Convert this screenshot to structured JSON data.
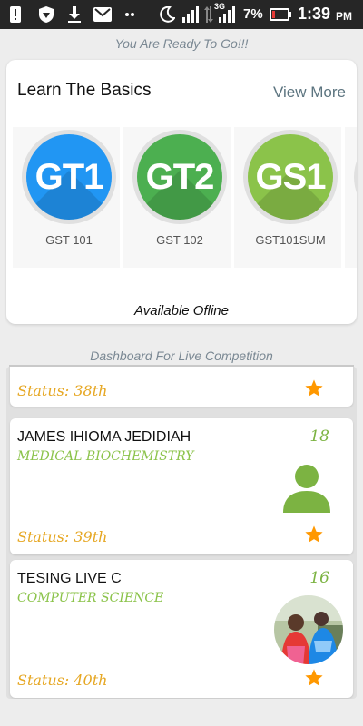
{
  "status_bar": {
    "battery_percent": "7%",
    "network": "3G",
    "time": "1:39",
    "ampm": "PM",
    "icons": [
      "alert-icon",
      "shield-icon",
      "download-icon",
      "mail-icon",
      "more-icon",
      "moon-icon",
      "signal-icon",
      "data-arrows-icon",
      "signal-icon",
      "battery-icon"
    ]
  },
  "header": {
    "tagline": "You Are Ready To Go!!!"
  },
  "basics": {
    "title": "Learn The Basics",
    "view_more": "View More",
    "courses": [
      {
        "badge": "GT1",
        "label": "GST 101",
        "color": "#2196f3"
      },
      {
        "badge": "GT2",
        "label": "GST 102",
        "color": "#4caf50"
      },
      {
        "badge": "GS1",
        "label": "GST101SUM",
        "color": "#8bc34a"
      }
    ],
    "partial_course_color": "#00897b",
    "offline_note": "Available Ofline"
  },
  "dashboard": {
    "title": "Dashboard For Live Competition",
    "entries": [
      {
        "status": "Status: 38th"
      },
      {
        "name": "JAMES IHIOMA JEDIDIAH",
        "department": "MEDICAL BIOCHEMISTRY",
        "score": "18",
        "status": "Status: 39th",
        "avatar": "default-avatar-icon"
      },
      {
        "name": "TESING LIVE C",
        "department": "COMPUTER SCIENCE",
        "score": "16",
        "status": "Status: 40th",
        "avatar": "photo"
      }
    ]
  },
  "colors": {
    "accent_green": "#8bc34a",
    "status_gold": "#e6a723",
    "star": "#ff9800"
  }
}
